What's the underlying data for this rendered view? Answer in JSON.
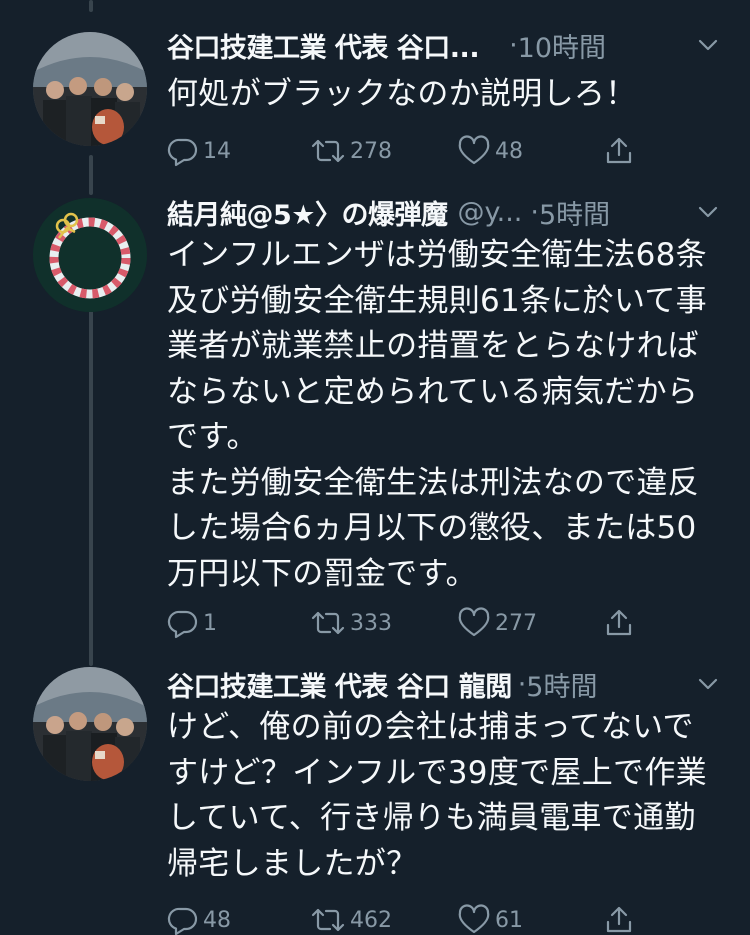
{
  "tweets": [
    {
      "name": "谷口技建工業 代表 谷口...",
      "handle": "",
      "dot": "·",
      "time": "10時間",
      "text": "何処がブラックなのか説明しろ！",
      "replies": "14",
      "retweets": "278",
      "likes": "48"
    },
    {
      "name": "結月純@5★〉の爆弾魔",
      "handle": "@y...",
      "dot": "·",
      "time": "5時間",
      "text": "インフルエンザは労働安全衛生法68条\n及び労働安全衛生規則61条に於いて事\n業者が就業禁止の措置をとらなければ\nならないと定められている病気だから\nです。\nまた労働安全衛生法は刑法なので違反\nした場合6ヵ月以下の懲役、または50\n万円以下の罰金です。",
      "replies": "1",
      "retweets": "333",
      "likes": "277"
    },
    {
      "name": "谷口技建工業 代表 谷口 龍閲",
      "handle": "",
      "dot": "·",
      "time": "5時間",
      "text": "けど、俺の前の会社は捕まってないで\nすけど？インフルで39度で屋上で作業\nしていて、行き帰りも満員電車で通勤\n帰宅しましたが？",
      "replies": "48",
      "retweets": "462",
      "likes": "61"
    }
  ],
  "icons": {
    "reply": "reply-icon",
    "retweet": "retweet-icon",
    "like": "heart-icon",
    "share": "share-icon",
    "more": "chevron-down-icon"
  },
  "colors": {
    "background": "#15202b",
    "secondary_text": "#8899a6",
    "thread_line": "#38444d"
  }
}
